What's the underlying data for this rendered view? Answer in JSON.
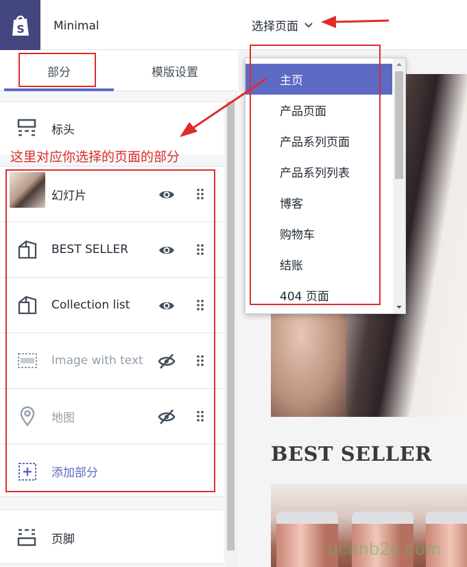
{
  "app": {
    "theme_name": "Minimal",
    "brand_color": "#43467f",
    "accent_color": "#5c6ac4",
    "annotation_color": "#e02b2b"
  },
  "tabs": [
    {
      "label": "部分",
      "active": true
    },
    {
      "label": "模版设置",
      "active": false
    }
  ],
  "sections": {
    "header": {
      "label": "标头",
      "icon": "header-layout-icon"
    },
    "annotation": "这里对应你选择的页面的部分",
    "items": [
      {
        "label": "幻灯片",
        "icon": "slideshow-thumbnail",
        "visible": true
      },
      {
        "label": "BEST SELLER",
        "icon": "collection-icon",
        "visible": true
      },
      {
        "label": "Collection list",
        "icon": "collection-icon",
        "visible": true
      },
      {
        "label": "Image with text",
        "icon": "image-text-icon",
        "visible": false
      },
      {
        "label": "地图",
        "icon": "map-pin-icon",
        "visible": false
      }
    ],
    "add_section": "添加部分",
    "footer": {
      "label": "页脚",
      "icon": "footer-layout-icon"
    }
  },
  "page_selector": {
    "label": "选择页面",
    "options": [
      "主页",
      "产品页面",
      "产品系列页面",
      "产品系列列表",
      "博客",
      "购物车",
      "结账",
      "404 页面"
    ],
    "selected": "主页"
  },
  "preview": {
    "heading": "BEST SELLER"
  },
  "watermark": "ucanb2c.com"
}
